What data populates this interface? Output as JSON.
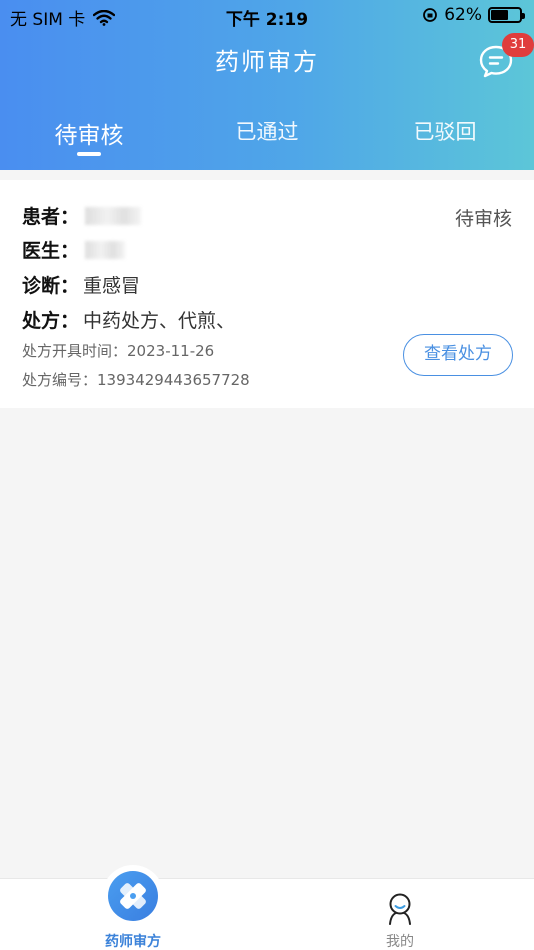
{
  "status_bar": {
    "carrier": "无 SIM 卡",
    "time": "下午 2:19",
    "battery": "62%",
    "battery_level": 0.62
  },
  "header": {
    "title": "药师审方",
    "message_badge": "31"
  },
  "tabs": [
    {
      "label": "待审核",
      "active": true
    },
    {
      "label": "已通过",
      "active": false
    },
    {
      "label": "已驳回",
      "active": false
    }
  ],
  "card": {
    "patient_label": "患者：",
    "doctor_label": "医生：",
    "diagnosis_label": "诊断：",
    "diagnosis_value": "重感冒",
    "prescription_label": "处方：",
    "prescription_value": "中药处方、代煎、",
    "status": "待审核",
    "issue_time_label": "处方开具时间：",
    "issue_time_value": "2023-11-26",
    "number_label": "处方编号：",
    "number_value": "1393429443657728",
    "view_button": "查看处方"
  },
  "tabbar": {
    "items": [
      {
        "label": "药师审方",
        "icon": "pharmacist-icon",
        "active": true
      },
      {
        "label": "我的",
        "icon": "profile-icon",
        "active": false
      }
    ]
  },
  "colors": {
    "accent": "#4a90e2",
    "badge": "#e03d3d"
  }
}
